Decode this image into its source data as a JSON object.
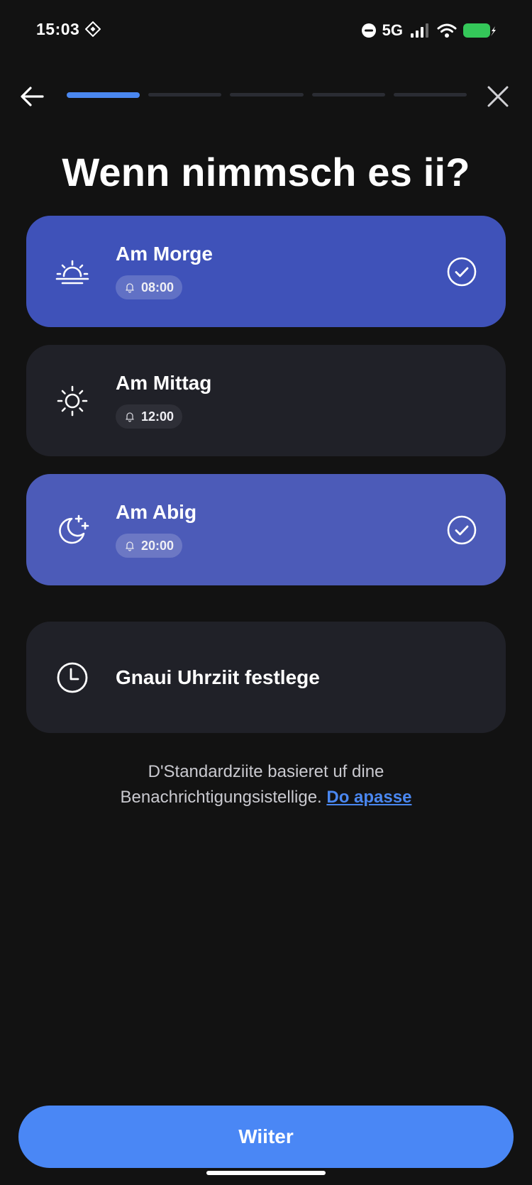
{
  "status_bar": {
    "time": "15:03",
    "network": "5G",
    "icons": [
      "diamond-icon",
      "do-not-disturb-icon",
      "signal-icon",
      "wifi-icon",
      "battery-charging-icon"
    ],
    "battery_color": "#34c759"
  },
  "nav": {
    "back_icon": "arrow-left-icon",
    "close_icon": "close-icon",
    "progress_step": 1,
    "progress_total": 5
  },
  "title": "Wenn nimmsch es ii?",
  "options": [
    {
      "icon": "sunrise-icon",
      "label": "Am Morge",
      "time": "08:00",
      "selected": true
    },
    {
      "icon": "sun-icon",
      "label": "Am Mittag",
      "time": "12:00",
      "selected": false
    },
    {
      "icon": "moon-stars-icon",
      "label": "Am Abig",
      "time": "20:00",
      "selected": true
    },
    {
      "icon": "clock-icon",
      "label": "Gnaui Uhrziit festlege",
      "selected": false
    }
  ],
  "hint": {
    "line1": "D'Standardziite basieret uf dine",
    "line2": "Benachrichtigungsistellige.",
    "link": "Do apasse"
  },
  "continue_label": "Wiiter",
  "colors": {
    "background": "#121212",
    "accent": "#4a87f5",
    "selected_card": "#3f52b9",
    "card": "#202128"
  }
}
